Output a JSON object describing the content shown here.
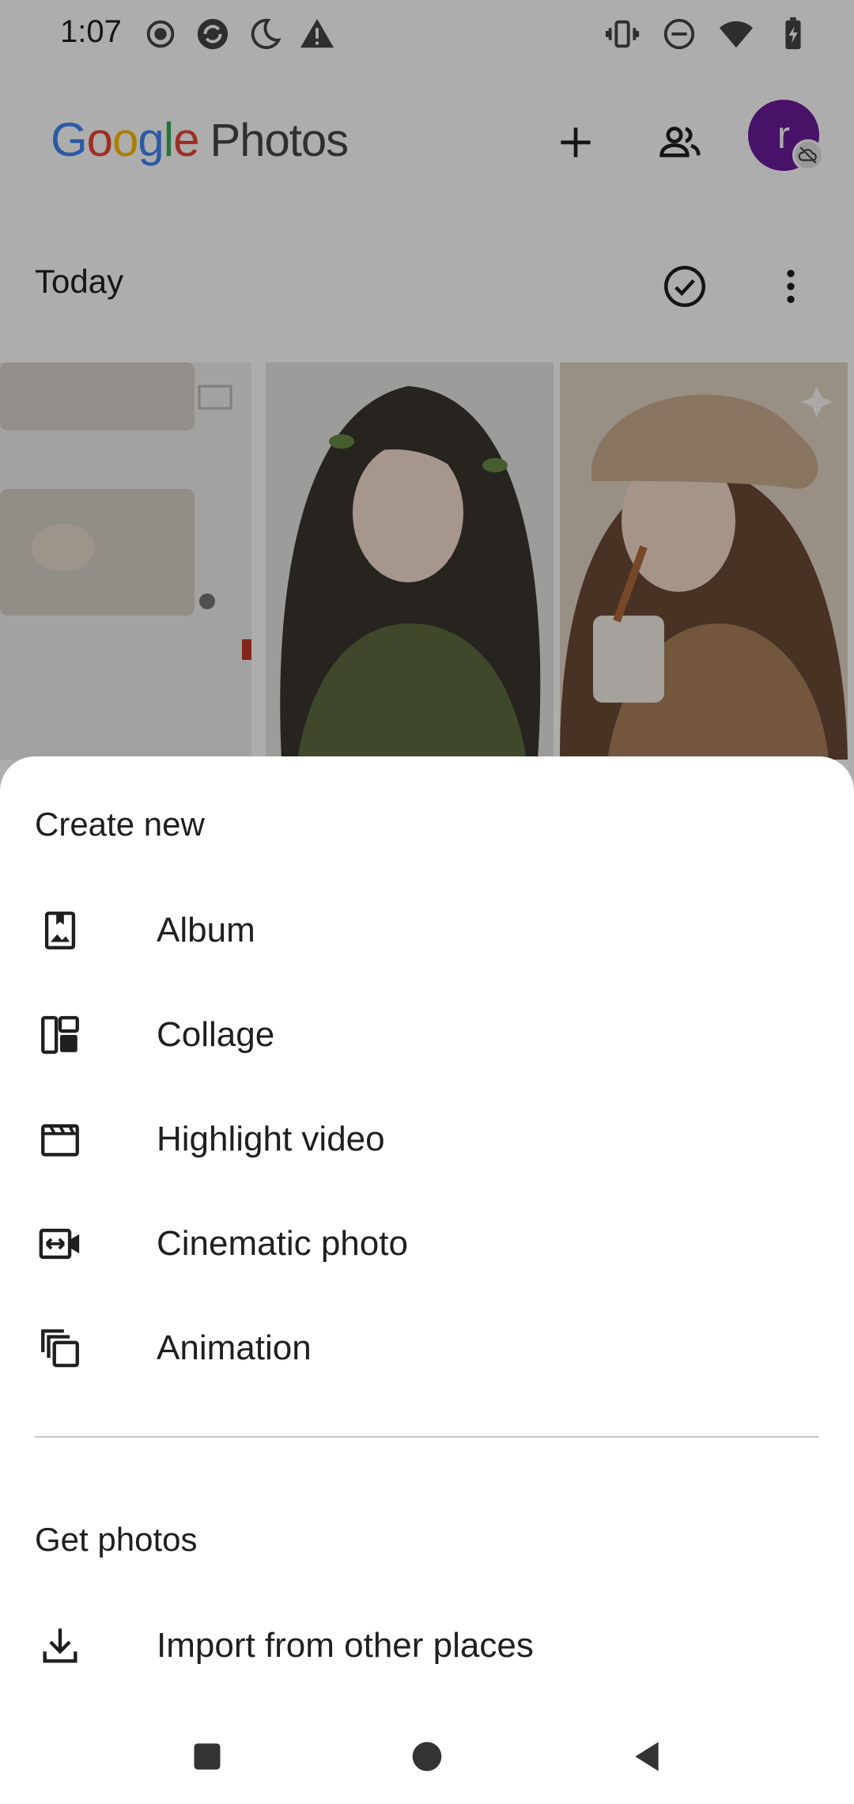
{
  "status_bar": {
    "time": "1:07",
    "left_icons": [
      "record-icon",
      "sync-icon",
      "night-mode-icon",
      "warning-icon"
    ],
    "right_icons": [
      "vibrate-icon",
      "do-not-disturb-icon",
      "wifi-icon",
      "battery-charging-icon"
    ]
  },
  "app_bar": {
    "logo_letters": [
      "G",
      "o",
      "o",
      "g",
      "l",
      "e"
    ],
    "product_name": "Photos",
    "avatar_initial": "r",
    "avatar_color": "#6a1b9a",
    "actions": [
      "add-icon",
      "sharing-people-icon"
    ]
  },
  "section": {
    "title": "Today",
    "actions": [
      "select-check-icon",
      "more-vert-icon"
    ]
  },
  "sheet": {
    "create_heading": "Create new",
    "create_items": [
      {
        "label": "Album",
        "icon": "album-icon"
      },
      {
        "label": "Collage",
        "icon": "collage-icon"
      },
      {
        "label": "Highlight video",
        "icon": "highlight-video-icon"
      },
      {
        "label": "Cinematic photo",
        "icon": "cinematic-photo-icon"
      },
      {
        "label": "Animation",
        "icon": "animation-icon"
      }
    ],
    "get_heading": "Get photos",
    "get_items": [
      {
        "label": "Import from other places",
        "icon": "download-icon"
      }
    ]
  },
  "nav_bar": {
    "buttons": [
      "recents-button",
      "home-button",
      "back-button"
    ]
  },
  "colors": {
    "scrim": "rgba(0,0,0,0.32)",
    "text_primary": "#1f1f1f",
    "divider": "#c4c7c5"
  }
}
